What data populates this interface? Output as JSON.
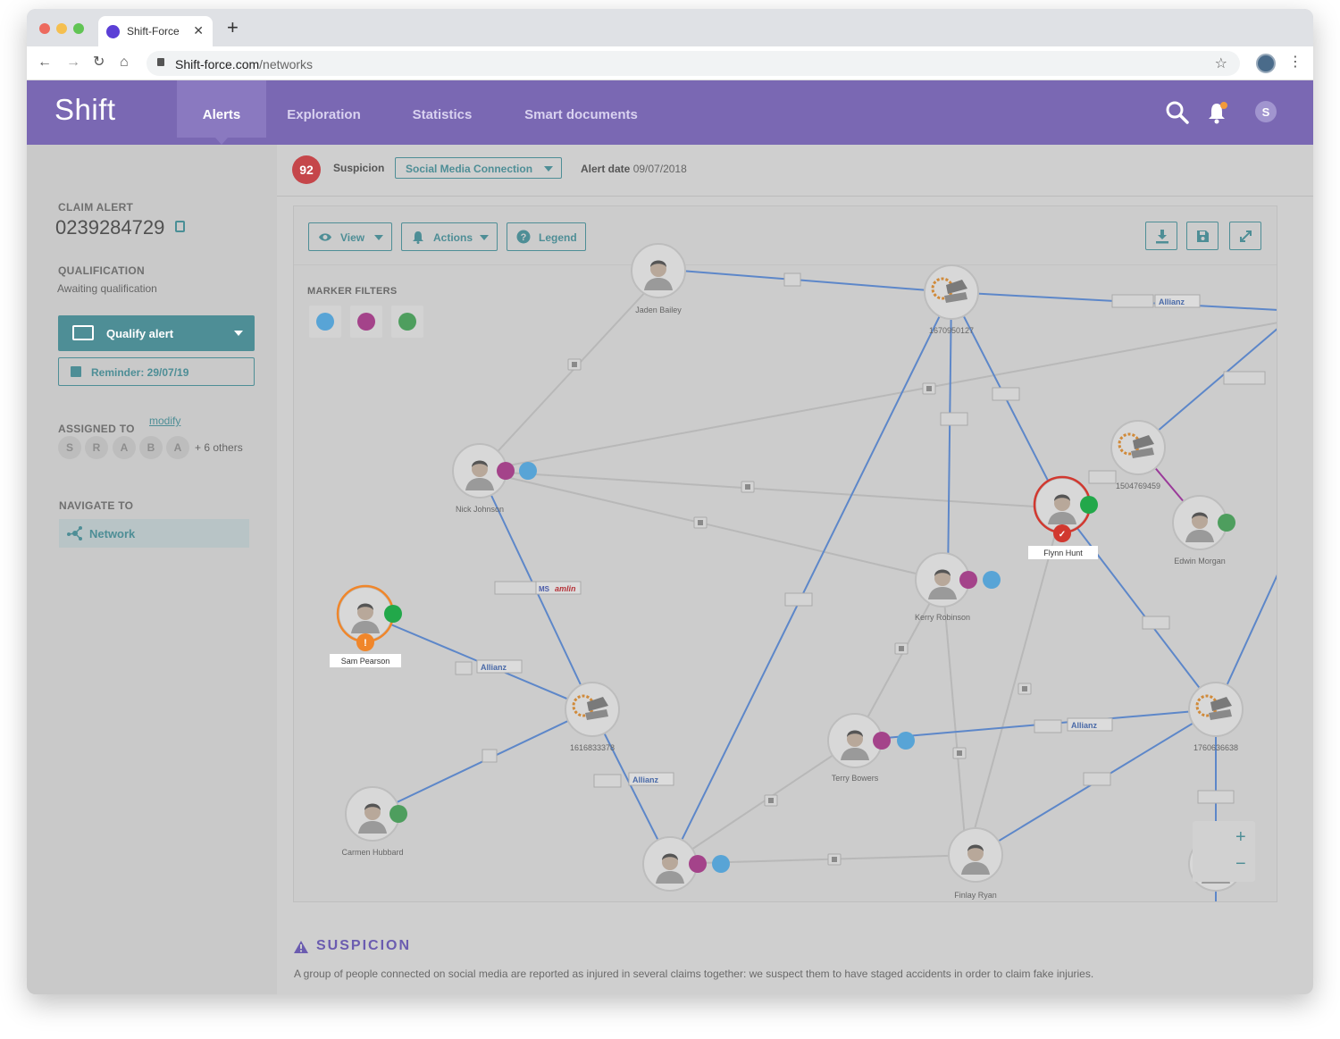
{
  "browser": {
    "tab_title": "Shift-Force",
    "url_domain": "Shift-force.com",
    "url_path": "/networks"
  },
  "app": {
    "logo": "Shift",
    "nav": [
      {
        "label": "Alerts",
        "active": true
      },
      {
        "label": "Exploration",
        "active": false
      },
      {
        "label": "Statistics",
        "active": false
      },
      {
        "label": "Smart documents",
        "active": false
      }
    ],
    "user_initial": "S",
    "colors": {
      "header": "#7a68b3",
      "accent": "#4e8e96",
      "score": "#c5464a"
    }
  },
  "sidebar": {
    "claim_alert_label": "CLAIM ALERT",
    "claim_number": "0239284729",
    "qualification_label": "QUALIFICATION",
    "qualification_value": "Awaiting qualification",
    "qualify_button": "Qualify alert",
    "reminder_button": "Reminder: 29/07/19",
    "assigned_label": "ASSIGNED TO",
    "modify_link": "modify",
    "assignees": [
      "S",
      "R",
      "A",
      "B",
      "A"
    ],
    "others": "+ 6 others",
    "navigate_label": "NAVIGATE TO",
    "nav_network": "Network"
  },
  "alert": {
    "score": "92",
    "suspicion_label": "Suspicion",
    "suspicion_value": "Social Media Connection",
    "date_label": "Alert date",
    "date_value": "09/07/2018"
  },
  "toolbar": {
    "view": "View",
    "actions": "Actions",
    "legend": "Legend"
  },
  "graph": {
    "marker_filters_label": "MARKER FILTERS",
    "people": {
      "jaden": "Jaden Bailey",
      "nick": "Nick Johnson",
      "sam": "Sam Pearson",
      "carmen": "Carmen Hubbard",
      "kerry": "Kerry Robinson",
      "terry": "Terry Bowers",
      "flynn": "Flynn Hunt",
      "edwin": "Edwin Morgan",
      "finlay": "Finlay Ryan"
    },
    "cars": {
      "c1": "1670950127",
      "c2": "1504769459",
      "c3": "1616833378",
      "c4": "1760636638"
    },
    "insurers": {
      "allianz": "Allianz",
      "amlin": "amlin",
      "ms": "MS"
    }
  },
  "suspicion_section": {
    "title": "SUSPICION",
    "description": "A group of people connected on social media are reported as injured in several claims together: we suspect them to have staged accidents in order to claim fake injuries."
  }
}
